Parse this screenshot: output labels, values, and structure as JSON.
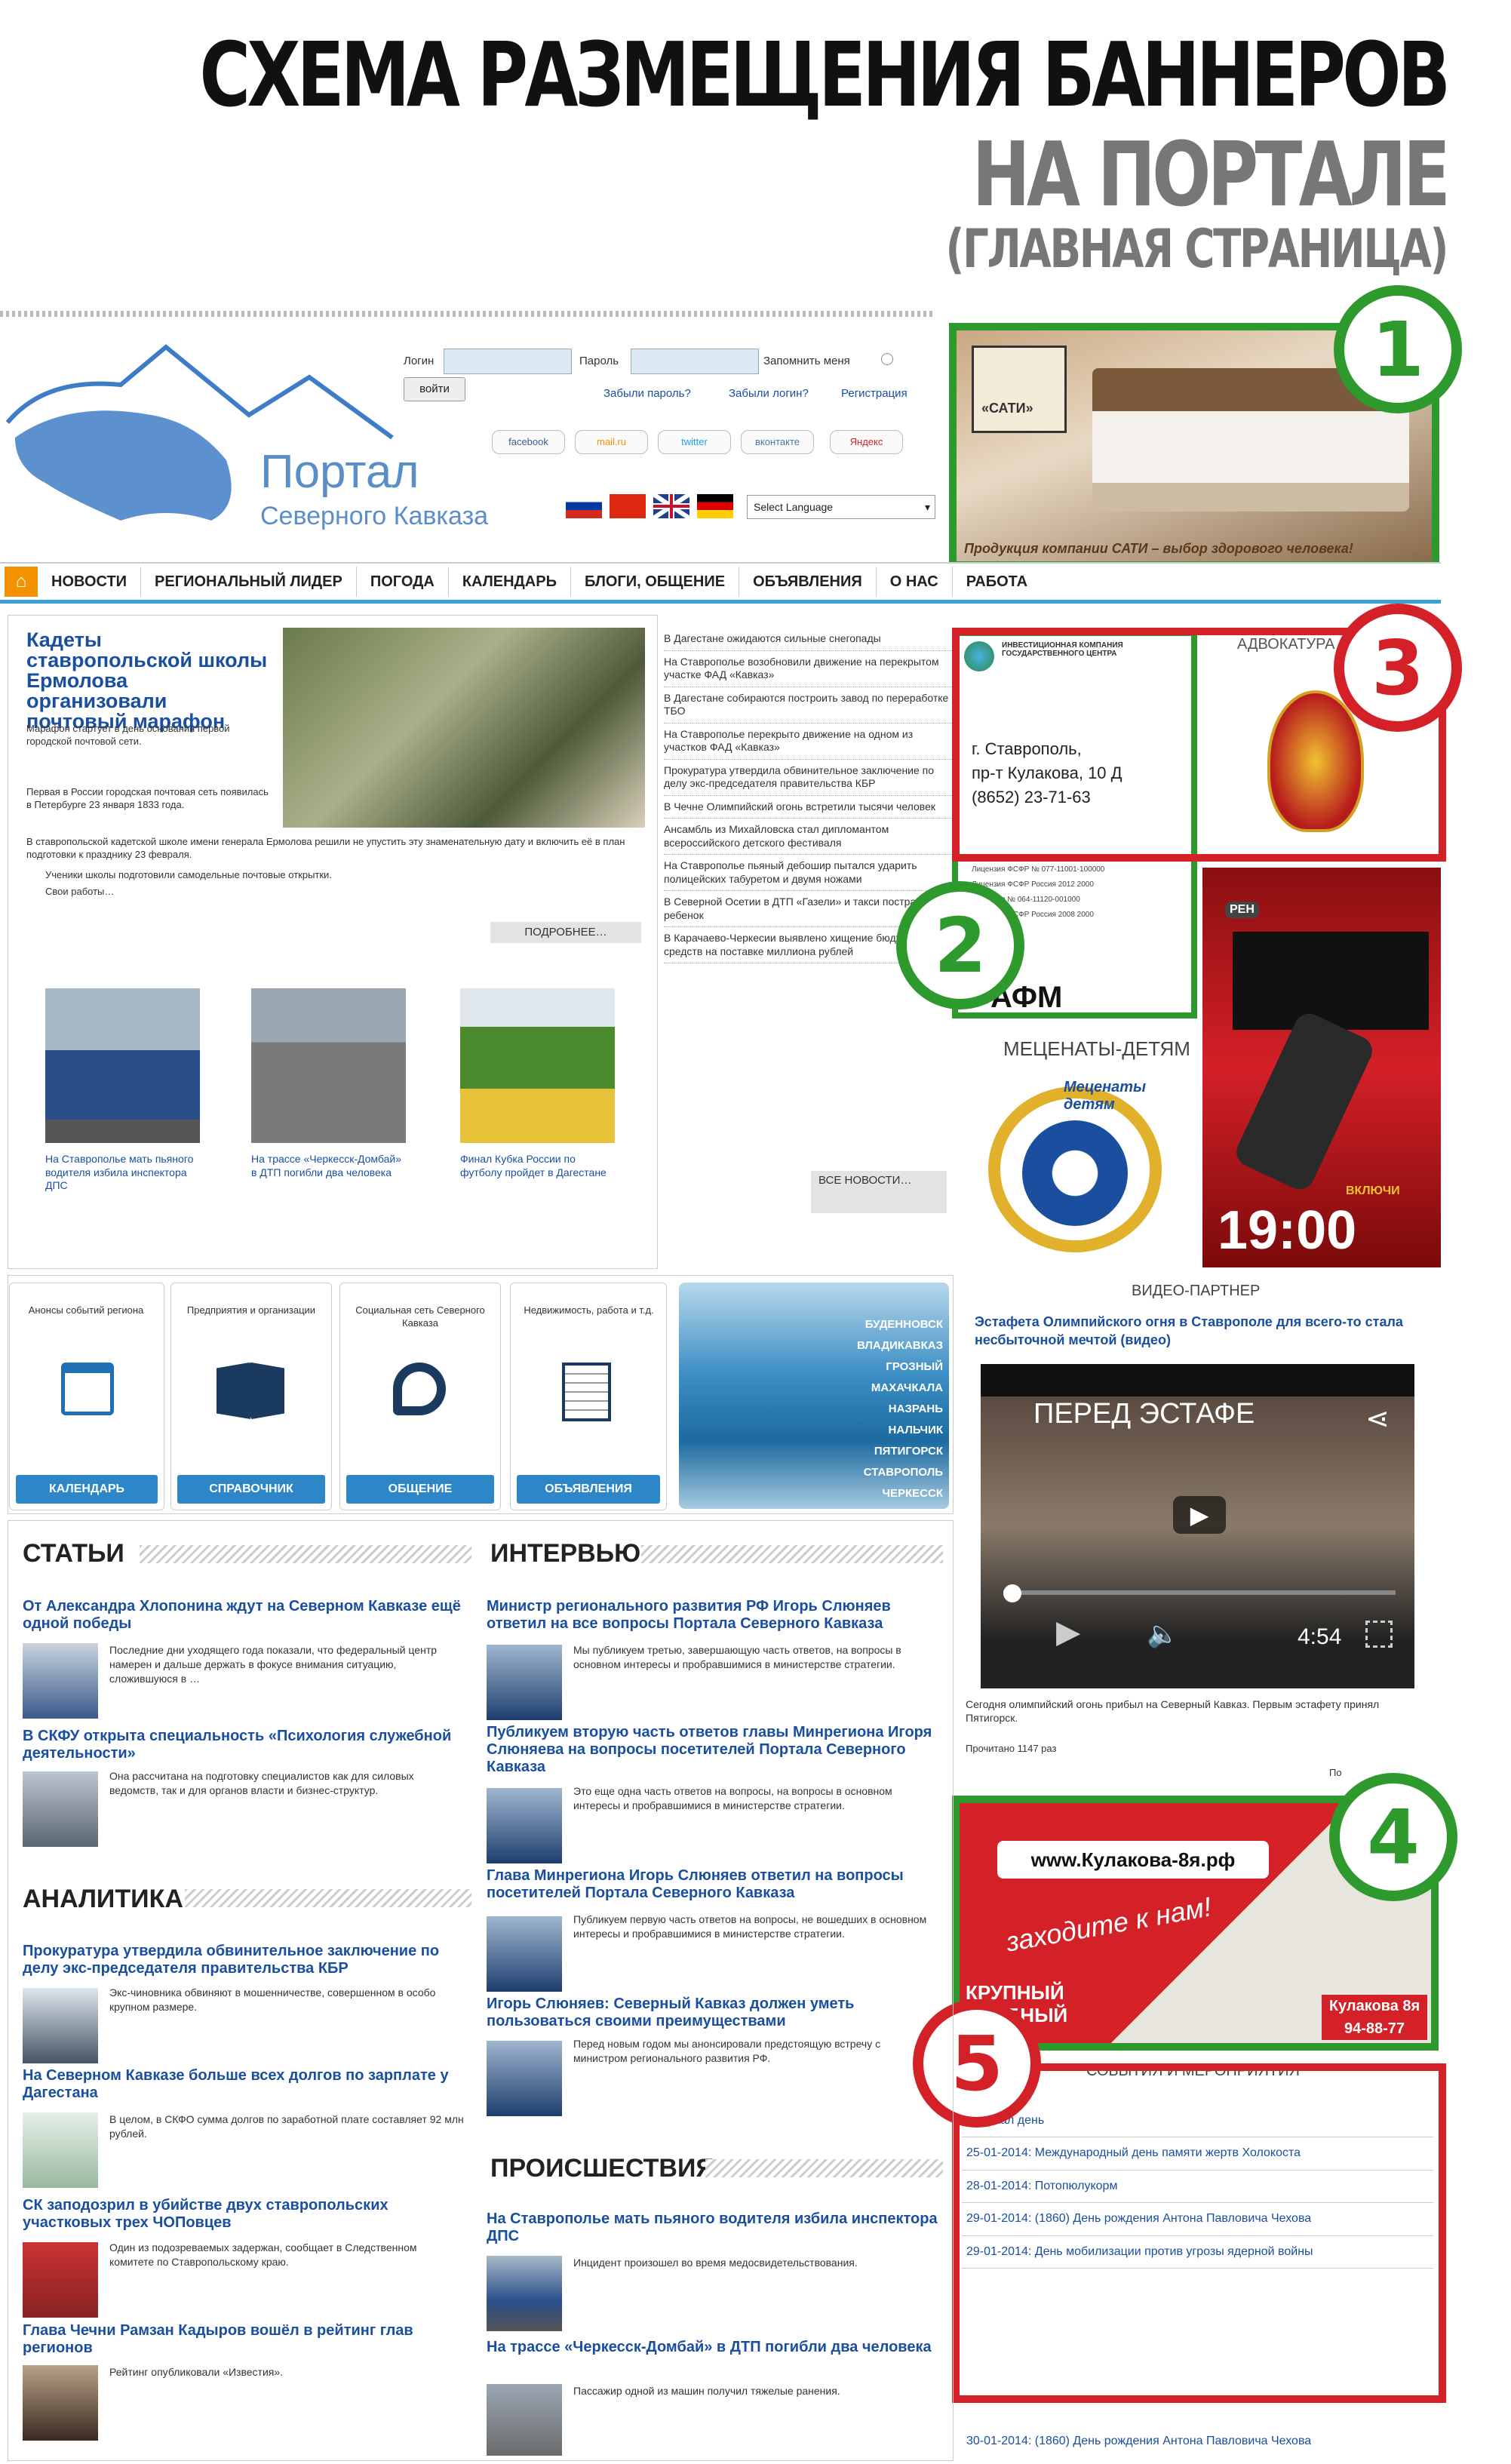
{
  "heading": {
    "line1": "СХЕМА РАЗМЕЩЕНИЯ БАННЕРОВ",
    "line2": "НА ПОРТАЛЕ",
    "line3": "(ГЛАВНАЯ СТРАНИЦА)"
  },
  "header": {
    "logo_title": "Портал",
    "logo_subtitle": "Северного Кавказа",
    "login_label": "Логин",
    "password_label": "Пароль",
    "remember_label": "Запомнить меня",
    "login_button": "войти",
    "links": [
      "Забыли пароль?",
      "Забыли логин?",
      "Регистрация"
    ],
    "social": [
      "facebook",
      "mail.ru",
      "twitter",
      "вконтакте",
      "Яндекс"
    ],
    "language_select": "Select Language"
  },
  "nav": {
    "items": [
      "НОВОСТИ",
      "РЕГИОНАЛЬНЫЙ ЛИДЕР",
      "ПОГОДА",
      "КАЛЕНДАРЬ",
      "БЛОГИ, ОБЩЕНИЕ",
      "ОБЪЯВЛЕНИЯ",
      "О НАС",
      "РАБОТА"
    ]
  },
  "main_story": {
    "title": "Кадеты ставропольской школы Ермолова организовали почтовый марафон",
    "lead": "Марафон стартует в день основания первой городской почтовой сети.",
    "p1": "Первая в России городская почтовая сеть появилась в Петербурге 23 января 1833 года.",
    "p2": "В ставропольской кадетской школе имени генерала Ермолова решили не упустить эту знаменательную дату и включить её в план подготовки к празднику 23 февраля.",
    "p3": "Ученики школы подготовили самодельные почтовые открытки.",
    "p4": "Свои работы…",
    "more": "ПОДРОБНЕЕ…"
  },
  "photo_news": [
    "На Ставрополье мать пьяного водителя избила инспектора ДПС",
    "На трассе «Черкесск-Домбай» в ДТП погибли два человека",
    "Финал Кубка России по футболу пройдет в Дагестане"
  ],
  "news_list": [
    "В Дагестане ожидаются сильные снегопады",
    "На Ставрополье возобновили движение на перекрытом участке ФАД «Кавказ»",
    "В Дагестане собираются построить завод по переработке ТБО",
    "На Ставрополье перекрыто движение на одном из участков ФАД «Кавказ»",
    "Прокуратура утвердила обвинительное заключение по делу экс-председателя правительства КБР",
    "В Чечне Олимпийский огонь встретили тысячи человек",
    "Ансамбль из Михайловска стал дипломантом всероссийского детского фестиваля",
    "На Ставрополье пьяный дебошир пытался ударить полицейских табуретом и двумя ножами",
    "В Северной Осетии в ДТП «Газели» и такси пострадал ребенок",
    "В Карачаево-Черкесии выявлено хищение бюджетных средств на поставке миллиона рублей"
  ],
  "all_news": "ВСЕ НОВОСТИ…",
  "ad2": {
    "org": "ИНВЕСТИЦИОННАЯ КОМПАНИЯ ГОСУДАРСТВЕННОГО ЦЕНТРА",
    "city": "г. Ставрополь,",
    "address": "пр-т Кулакова, 10 Д",
    "phone": "(8652) 23-71-63",
    "brand": "АФМ",
    "lic1": "Лицензия ФСФР № 077-11001-100000",
    "lic2": "Лицензия ФСФР Россия 2012 2000",
    "lic3": "Лицензия № 064-11120-001000",
    "lic4": "Лицензия ФСФР Россия 2008 2000"
  },
  "ad3": {
    "caption": "АДВОКАТУРА"
  },
  "ad1": {
    "brand": "«САТИ»",
    "slogan": "Продукция компании САТИ – выбор здорового человека!"
  },
  "ad4": {
    "site": "www.Кулакова-8я.рф",
    "slogan": "заходите к нам!",
    "line1": "КРУПНЫЙ",
    "line2": "УДОБНЫЙ",
    "badge": "Кулакова 8я",
    "phone": "94-88-77"
  },
  "menaty": {
    "caption": "МЕЦЕНАТЫ-ДЕТЯМ",
    "ribbon": "Меценаты детям"
  },
  "tv": {
    "logo": "РЕН",
    "time": "19:00",
    "label": "ВКЛЮЧИ"
  },
  "tabs": [
    {
      "desc": "Анонсы событий региона",
      "btn": "КАЛЕНДАРЬ"
    },
    {
      "desc": "Предприятия и организации",
      "btn": "СПРАВОЧНИК"
    },
    {
      "desc": "Социальная сеть Северного Кавказа",
      "btn": "ОБЩЕНИЕ"
    },
    {
      "desc": "Недвижимость, работа и т.д.",
      "btn": "ОБЪЯВЛЕНИЯ"
    }
  ],
  "cities": [
    "БУДЕННОВСК",
    "ВЛАДИКАВКАЗ",
    "ГРОЗНЫЙ",
    "МАХАЧКАЛА",
    "НАЗРАНЬ",
    "НАЛЬЧИК",
    "ПЯТИГОРСК",
    "СТАВРОПОЛЬ",
    "ЧЕРКЕССК"
  ],
  "video": {
    "caption": "ВИДЕО-ПАРТНЕР",
    "title": "Эстафета Олимпийского огня в Ставрополе для всего-то стала несбыточной мечтой (видео)",
    "player_title": "ПЕРЕД ЭСТАФЕ",
    "duration": "4:54",
    "desc": "Сегодня олимпийский огонь прибыл на Северный Кавказ. Первым эстафету принял Пятигорск.",
    "views": "Прочитано 1147 раз",
    "more": "По"
  },
  "events": {
    "caption": "СОБЫТИЯ И МЕРОПРИЯТИЯ",
    "items": [
      ": Пасхал день",
      "25-01-2014: Международный день памяти жертв Холокоста",
      "28-01-2014: Потопюлукорм",
      "29-01-2014: (1860) День рождения Антона Павловича Чехова",
      "29-01-2014: День мобилизации против угрозы ядерной войны",
      "30-01-2014: (1860) День рождения Антона Павловича Чехова"
    ]
  },
  "sections": {
    "articles": "СТАТЬИ",
    "interview": "ИНТЕРВЬЮ",
    "analytics": "АНАЛИТИКА",
    "incidents": "ПРОИСШЕСТВИЯ"
  },
  "articles": [
    {
      "title": "От Александра Хлопонина ждут на Северном Кавказе ещё одной победы",
      "text": "Последние дни уходящего года показали, что федеральный центр намерен и дальше держать в фокусе внимания ситуацию, сложившуюся в …"
    },
    {
      "title": "В СКФУ открыта специальность «Психология служебной деятельности»",
      "text": "Она рассчитана на подготовку специалистов как для силовых ведомств, так и для органов власти и бизнес-структур."
    }
  ],
  "analytics": [
    {
      "title": "Прокуратура утвердила обвинительное заключение по делу экс-председателя правительства КБР",
      "text": "Экс-чиновника обвиняют в мошенничестве, совершенном в особо крупном размере."
    },
    {
      "title": "На Северном Кавказе больше всех долгов по зарплате у Дагестана",
      "text": "В целом, в СКФО сумма долгов по заработной плате составляет 92 млн рублей."
    },
    {
      "title": "СК заподозрил в убийстве двух ставропольских участковых трех ЧОПовцев",
      "text": "Один из подозреваемых задержан, сообщает в Следственном комитете по Ставропольскому краю."
    },
    {
      "title": "Глава Чечни Рамзан Кадыров вошёл в рейтинг глав регионов",
      "text": "Рейтинг опубликовали «Известия»."
    }
  ],
  "interviews": [
    {
      "title": "Министр регионального развития РФ Игорь Слюняев ответил на все вопросы Портала Северного Кавказа",
      "text": "Мы публикуем третью, завершающую часть ответов, на вопросы в основном интересы и пробравшимися в министерстве стратегии."
    },
    {
      "title": "Публикуем вторую часть ответов главы Минрегиона Игоря Слюняева на вопросы посетителей Портала Северного Кавказа",
      "text": "Это еще одна часть ответов на вопросы, на вопросы в основном интересы и пробравшимися в министерстве стратегии."
    },
    {
      "title": "Глава Минрегиона Игорь Слюняев ответил на вопросы посетителей Портала Северного Кавказа",
      "text": "Публикуем первую часть ответов на вопросы, не вошедших в основном интересы и пробравшимися в министерстве стратегии."
    },
    {
      "title": "Игорь Слюняев: Северный Кавказ должен уметь пользоваться своими преимуществами",
      "text": "Перед новым годом мы анонсировали предстоящую встречу с министром регионального развития РФ."
    }
  ],
  "incidents": [
    {
      "title": "На Ставрополье мать пьяного водителя избила инспектора ДПС",
      "text": "Инцидент произошел во время медосвидетельствования."
    },
    {
      "title": "На трассе «Черкесск-Домбай» в ДТП погибли два человека",
      "text": "Пассажир одной из машин получил тяжелые ранения."
    }
  ],
  "markers": [
    "1",
    "2",
    "3",
    "4",
    "5"
  ],
  "colors": {
    "green": "#2e9a2e",
    "red": "#d42027",
    "nav_accent": "#3aa0d8",
    "link": "#1a4fa0"
  }
}
